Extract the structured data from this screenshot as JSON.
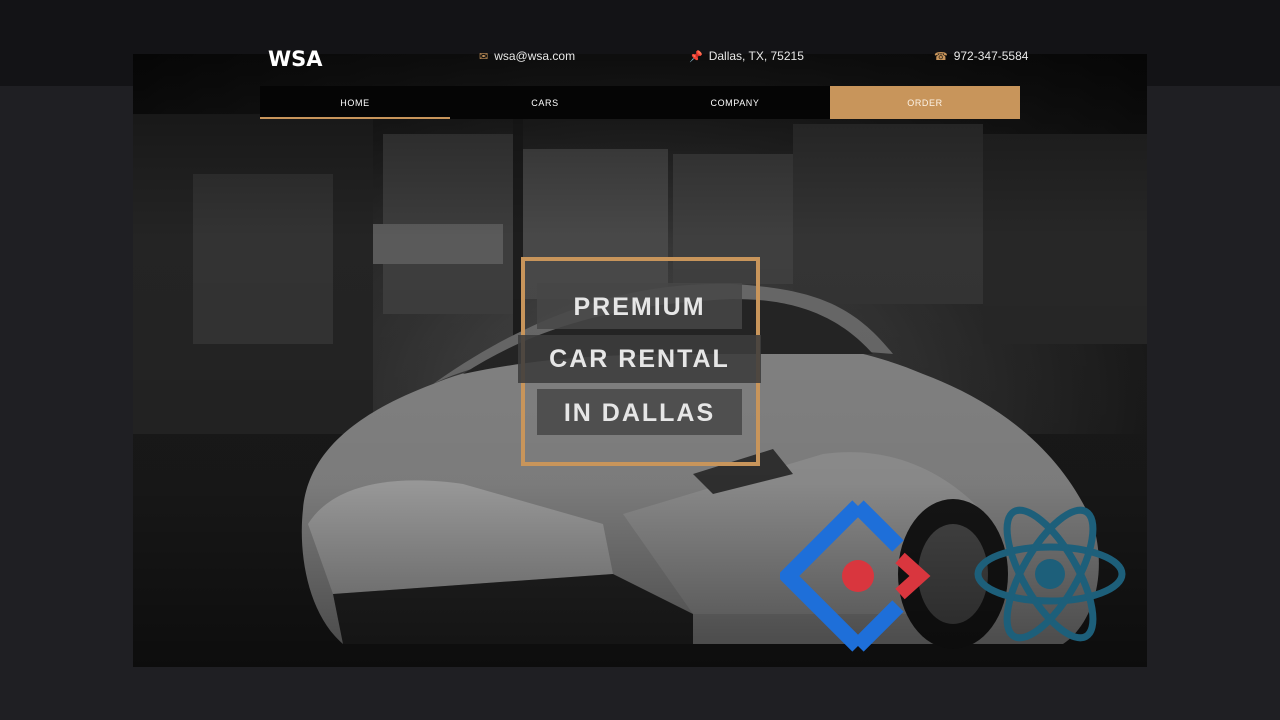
{
  "brand": {
    "logo_text": "WSA",
    "accent": "#c8955b"
  },
  "contact": {
    "email": {
      "icon": "envelope-icon",
      "text": "wsa@wsa.com"
    },
    "address": {
      "icon": "pin-icon",
      "text": "Dallas, TX, 75215"
    },
    "phone": {
      "icon": "phone-icon",
      "text": "972-347-5584"
    }
  },
  "nav": {
    "items": [
      {
        "label": "HOME",
        "active": true
      },
      {
        "label": "CARS"
      },
      {
        "label": "COMPANY"
      },
      {
        "label": "ORDER",
        "highlight": true
      }
    ]
  },
  "hero": {
    "title_lines": [
      "PREMIUM",
      "CAR RENTAL",
      "IN DALLAS"
    ]
  },
  "overlays": {
    "left_logo": "angular-style-logo-icon",
    "right_logo": "react-logo-icon",
    "colors": {
      "blue": "#1e6fd9",
      "red": "#d9363e",
      "react": "#1d5f7a"
    }
  }
}
